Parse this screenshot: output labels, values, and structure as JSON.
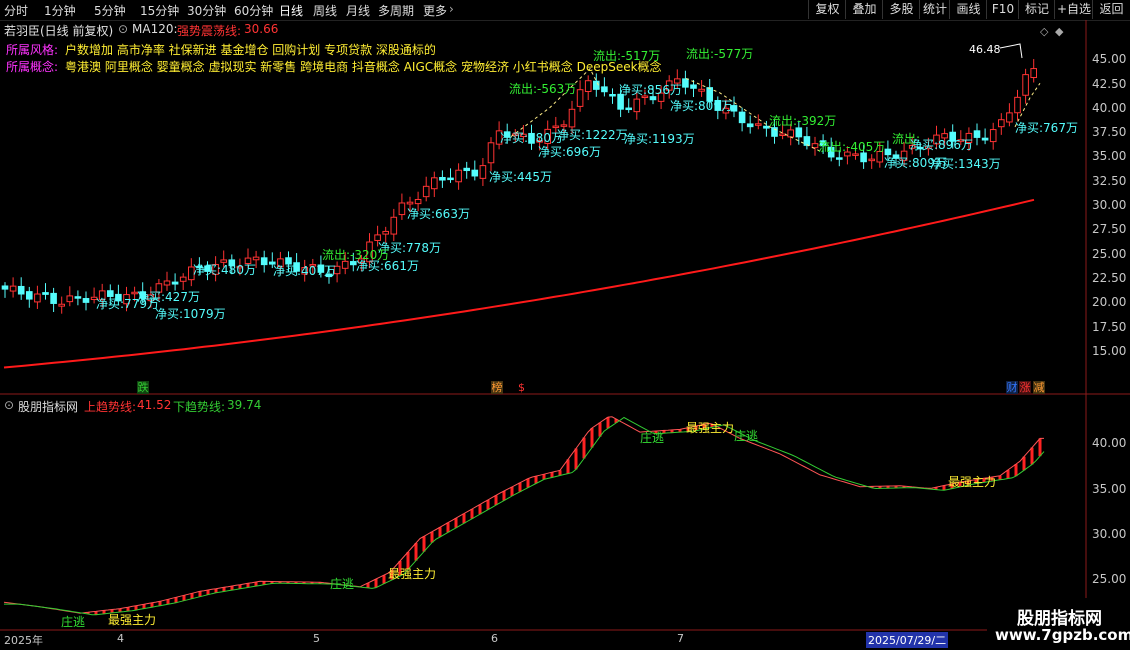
{
  "toolbar": {
    "left": [
      "分时",
      "1分钟",
      "5分钟",
      "15分钟",
      "30分钟",
      "60分钟",
      "日线",
      "周线",
      "月线",
      "多周期",
      "更多"
    ],
    "right": [
      "复权",
      "叠加",
      "多股",
      "统计",
      "画线",
      "F10",
      "标记",
      "+自选",
      "返回"
    ],
    "active": "日线"
  },
  "stock": {
    "title": "若羽臣(日线 前复权)",
    "ma_label": "MA120:",
    "trend_label": "强势震荡线:",
    "trend_value": "30.66"
  },
  "info": {
    "style_label": "所属风格:",
    "style_value": "户数增加 高市净率 社保新进 基金增仓 回购计划 专项贷款 深股通标的",
    "concept_label": "所属概念:",
    "concept_value": "粤港澳 阿里概念 婴童概念 虚拟现实 新零售 跨境电商 抖音概念 AIGC概念 宠物经济 小红书概念 DeepSeek概念"
  },
  "price_axis": [
    "45.00",
    "42.50",
    "40.00",
    "37.50",
    "35.00",
    "32.50",
    "30.00",
    "27.50",
    "25.00",
    "22.50",
    "20.00",
    "17.50",
    "15.00"
  ],
  "max_price_label": "46.48",
  "price_annotations": [
    {
      "text": "净买:767万",
      "type": "buy"
    },
    {
      "text": "流出:-577万",
      "type": "out"
    },
    {
      "text": "流出:-517万",
      "type": "out"
    },
    {
      "text": "流出:-563万",
      "type": "out"
    },
    {
      "text": "净买:1222万",
      "type": "buy"
    },
    {
      "text": "净买:856万",
      "type": "buy"
    },
    {
      "text": "净买:809万",
      "type": "buy"
    },
    {
      "text": "净买:1193万",
      "type": "buy"
    },
    {
      "text": "净买:696万",
      "type": "buy"
    },
    {
      "text": "净买:580万",
      "type": "buy"
    },
    {
      "text": "净买:445万",
      "type": "buy"
    },
    {
      "text": "流出:-392万",
      "type": "out"
    },
    {
      "text": "流出:-405万",
      "type": "out"
    },
    {
      "text": "流出:",
      "type": "out"
    },
    {
      "text": "净买:896万",
      "type": "buy"
    },
    {
      "text": "净买:809万",
      "type": "buy"
    },
    {
      "text": "净买:1343万",
      "type": "buy"
    },
    {
      "text": "净买:663万",
      "type": "buy"
    },
    {
      "text": "净买:778万",
      "type": "buy"
    },
    {
      "text": "流出:-320万",
      "type": "out"
    },
    {
      "text": "净买:661万",
      "type": "buy"
    },
    {
      "text": "净买:407万",
      "type": "buy"
    },
    {
      "text": "净买:480万",
      "type": "buy"
    },
    {
      "text": "净买:427万",
      "type": "buy"
    },
    {
      "text": "净买:779万",
      "type": "buy"
    },
    {
      "text": "净买:1079万",
      "type": "buy"
    }
  ],
  "events": [
    {
      "text": "跌",
      "color": "#33cc33"
    },
    {
      "text": "榜",
      "color": "#ff9933"
    },
    {
      "text": "$",
      "color": "#ff3333"
    },
    {
      "text": "财",
      "color": "#3377ff"
    },
    {
      "text": "涨",
      "color": "#ff3333"
    },
    {
      "text": "减",
      "color": "#ff9933"
    }
  ],
  "indicator": {
    "name": "股朋指标网",
    "up_label": "上趋势线:",
    "up_value": "41.52",
    "down_label": "下趋势线:",
    "down_value": "39.74",
    "axis": [
      "40.00",
      "35.00",
      "30.00",
      "25.00"
    ],
    "labels": [
      {
        "text": "庄逃",
        "color": "#33dd33"
      },
      {
        "text": "最强主力",
        "color": "#ffee33"
      },
      {
        "text": "庄逃",
        "color": "#33dd33"
      },
      {
        "text": "最强主力",
        "color": "#ffee33"
      },
      {
        "text": "庄逃",
        "color": "#33dd33"
      },
      {
        "text": "最强主力",
        "color": "#ffee33"
      },
      {
        "text": "庄逃",
        "color": "#33dd33"
      },
      {
        "text": "最强主力",
        "color": "#ffee33"
      }
    ]
  },
  "date_axis": [
    "2025年",
    "4",
    "5",
    "6",
    "7",
    "2025/07/29/二"
  ],
  "watermark": {
    "title": "股朋指标网",
    "url": "www.7gpzb.com"
  },
  "colors": {
    "up": "#ff3333",
    "down": "#54fcfc",
    "ma": "#ff1a1a",
    "pos_line": "#ff2222",
    "neg_line": "#33cc33"
  }
}
